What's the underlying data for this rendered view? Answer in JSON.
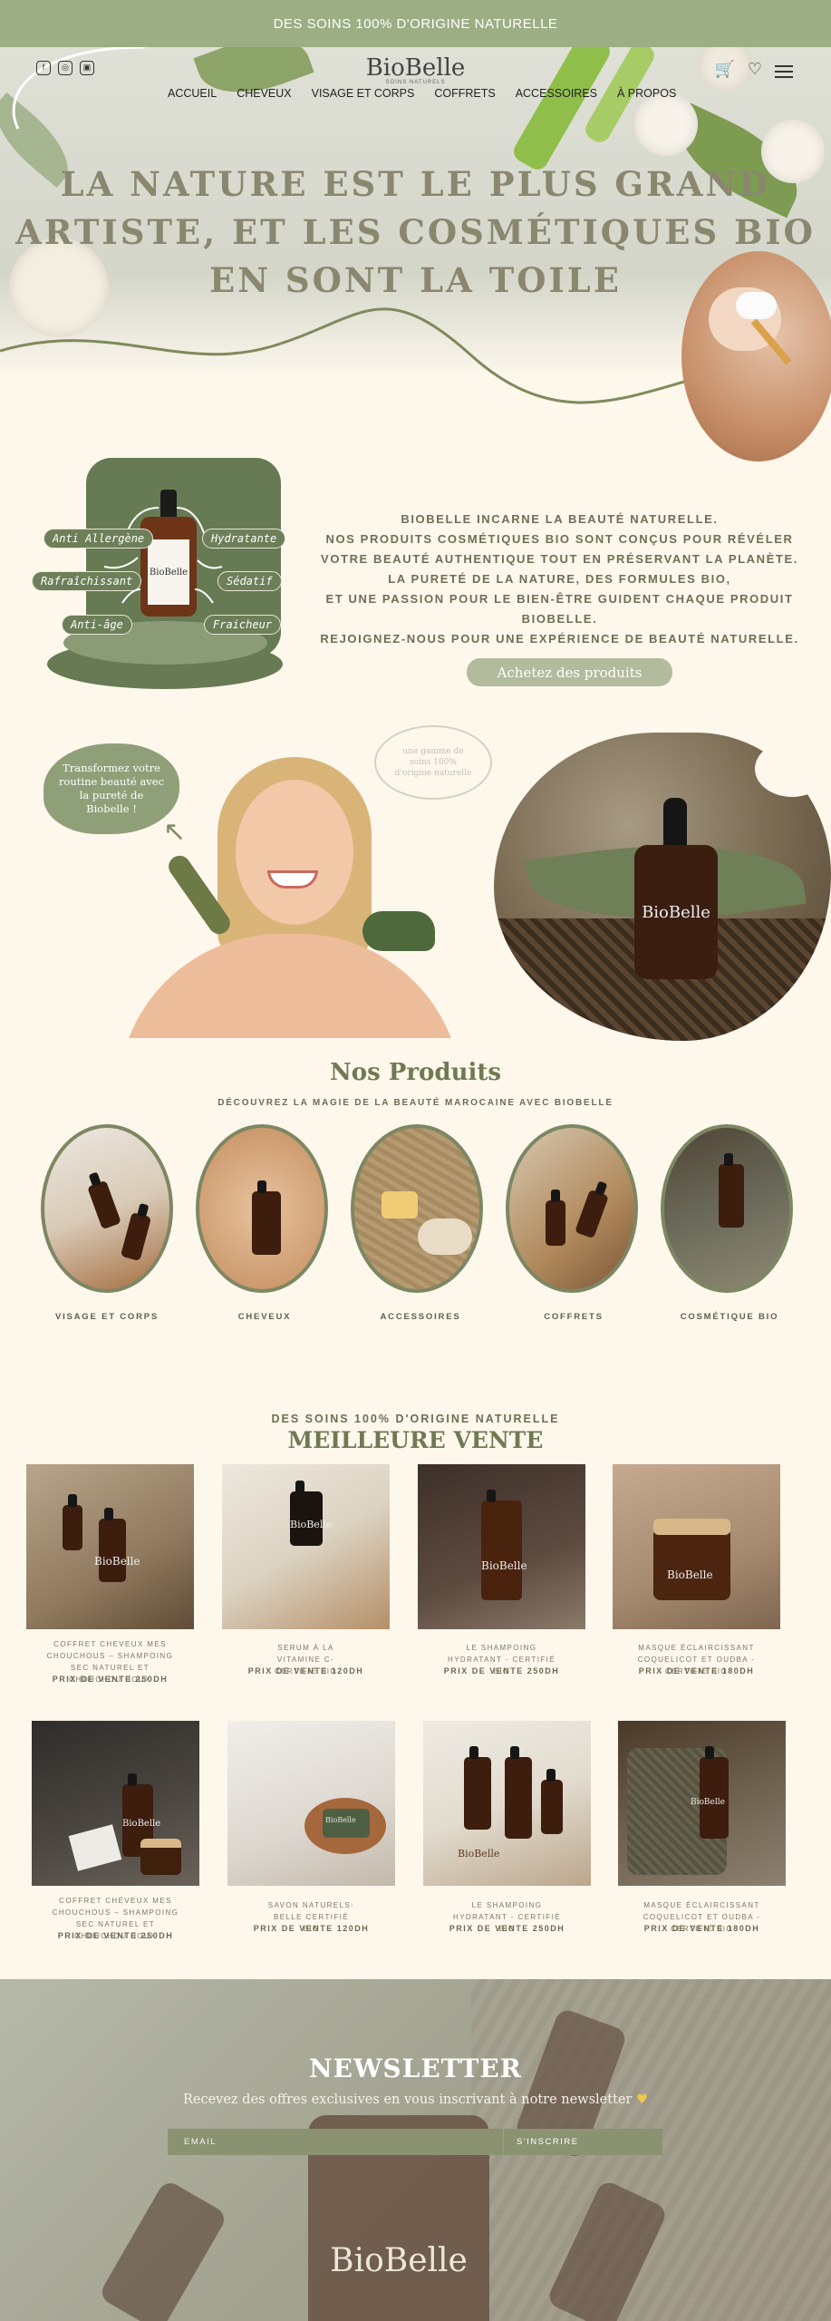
{
  "topbar": {
    "text": "DES SOINS 100% D'ORIGINE NATURELLE"
  },
  "header": {
    "logo": "BioBelle",
    "logo_sub": "SOINS NATURELS",
    "nav": [
      "ACCUEIL",
      "CHEVEUX",
      "VISAGE ET CORPS",
      "COFFRETS",
      "ACCESSOIRES",
      "À PROPOS"
    ],
    "icons": [
      "facebook-icon",
      "instagram-icon",
      "other-social-icon",
      "cart-icon",
      "heart-icon",
      "menu-icon"
    ]
  },
  "hero": {
    "title_lines": [
      "LA NATURE EST LE PLUS GRAND",
      "ARTISTE, ET LES COSMÉTIQUES BIO",
      "EN SONT LA TOILE"
    ]
  },
  "intro": {
    "benefits": [
      "Anti Allergène",
      "Hydratante",
      "Rafraîchissant",
      "Sédatif",
      "Anti-âge",
      "Fraicheur"
    ],
    "bottle_label": "BioBelle",
    "lines": [
      "BIOBELLE INCARNE LA BEAUTÉ NATURELLE.",
      "NOS PRODUITS COSMÉTIQUES BIO SONT CONÇUS POUR RÉVÉLER",
      "VOTRE BEAUTÉ AUTHENTIQUE TOUT EN PRÉSERVANT LA PLANÈTE.",
      "LA PURETÉ DE LA NATURE, DES FORMULES BIO,",
      "ET UNE PASSION POUR LE BIEN-ÊTRE GUIDENT CHAQUE PRODUIT",
      "BIOBELLE.",
      "REJOIGNEZ-NOUS POUR UNE EXPÉRIENCE DE BEAUTÉ NATURELLE."
    ],
    "cta": "Achetez des produits"
  },
  "promo": {
    "bubble_left": "Transformez votre routine beauté avec la pureté de Biobelle !",
    "bubble_right": "une gamme de soins 100% d'origine naturelle",
    "bottle_label": "BioBelle"
  },
  "products": {
    "title": "Nos Produits",
    "subtitle": "DÉCOUVREZ LA MAGIE DE LA BEAUTÉ MAROCAINE AVEC BIOBELLE",
    "categories": [
      "VISAGE ET CORPS",
      "CHEVEUX",
      "ACCESSOIRES",
      "COFFRETS",
      "COSMÉTIQUE BIO"
    ]
  },
  "bestsellers": {
    "kicker": "DES SOINS 100% D'ORIGINE NATURELLE",
    "title": "MEILLEURE VENTE",
    "items": [
      {
        "name": "COFFRET CHEVEUX MES CHOUCHOUS – SHAMPOING SEC NATUREL ET CHOUCHOU DOUX",
        "price": "PRIX DE VENTE 250DH"
      },
      {
        "name": "SERUM À LA VITAMINE C- CERTIFIÉ BIO",
        "price": "PRIX DE VENTE 120DH"
      },
      {
        "name": "LE SHAMPOING HYDRATANT - CERTIFIÉ BIO",
        "price": "PRIX DE VENTE 250DH"
      },
      {
        "name": "MASQUE ÉCLAIRCISSANT COQUELICOT ET OUDBA - CERTIFIÉ BIO",
        "price": "PRIX DE VENTE 180DH"
      },
      {
        "name": "COFFRET CHEVEUX MES CHOUCHOUS – SHAMPOING SEC NATUREL ET CHOUCHOU DOUX",
        "price": "PRIX DE VENTE 250DH"
      },
      {
        "name": "SAVON NATURELS-BELLE CERTIFIÉ BIO",
        "price": "PRIX DE VENTE 120DH"
      },
      {
        "name": "LE SHAMPOING HYDRATANT - CERTIFIÉ BIO",
        "price": "PRIX DE VENTE 250DH"
      },
      {
        "name": "MASQUE ÉCLAIRCISSANT COQUELICOT ET OUDBA - CERTIFIÉ BIO",
        "price": "PRIX DE VENTE 180DH"
      }
    ],
    "image_labels": [
      "BioBelle",
      "BioBelle",
      "BioBelle",
      "BioBelle",
      "BioBelle",
      "BioBelle",
      "BioBelle",
      "BioBelle"
    ]
  },
  "newsletter": {
    "title": "NEWSLETTER",
    "subtitle": "Recevez des offres exclusives en vous inscrivant à notre newsletter",
    "heart": "♥",
    "email_placeholder": "EMAIL",
    "button": "S'INSCRIRE",
    "bottle_label": "BioBelle"
  }
}
